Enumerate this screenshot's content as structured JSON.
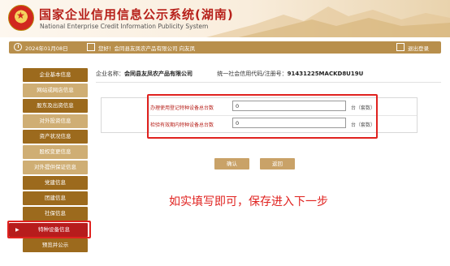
{
  "header": {
    "title": "国家企业信用信息公示系统",
    "province": "(湖南)",
    "subtitle": "National Enterprise Credit Information Publicity System"
  },
  "toolbar": {
    "date": "2024年01月08日",
    "welcome": "您好！会同县友凤农产品有限公司  向友凤",
    "logout_label": "退出登录"
  },
  "sidebar": {
    "items": [
      {
        "label": "企业基本信息",
        "style": "dark"
      },
      {
        "label": "网站或网店信息",
        "style": "light"
      },
      {
        "label": "股东及出资信息",
        "style": "dark"
      },
      {
        "label": "对外投资信息",
        "style": "light"
      },
      {
        "label": "资产状况信息",
        "style": "dark"
      },
      {
        "label": "股权变更信息",
        "style": "light"
      },
      {
        "label": "对外提供保证信息",
        "style": "light"
      },
      {
        "label": "党建信息",
        "style": "dark"
      },
      {
        "label": "团建信息",
        "style": "dark"
      },
      {
        "label": "社保信息",
        "style": "dark"
      },
      {
        "label": "特种设备信息",
        "style": "active"
      },
      {
        "label": "预览并公示",
        "style": "dark"
      }
    ]
  },
  "company": {
    "name_label": "企业名称：",
    "name": "会同县友凤农产品有限公司",
    "code_label": "统一社会信用代码/注册号：",
    "code": "91431225MACKD8U19U"
  },
  "form": {
    "fields": [
      {
        "label": "办理使用登记特种设备总台数",
        "value": "0",
        "unit": "台（套数）"
      },
      {
        "label": "检验有效期内特种设备总台数",
        "value": "0",
        "unit": "台（套数）"
      }
    ]
  },
  "buttons": {
    "confirm": "确认",
    "back": "返回"
  },
  "caption": "如实填写即可，保存进入下一步",
  "colors": {
    "header_title": "#b7211b",
    "toolbar": "#b88f4c",
    "sidebar_dark": "#9c6a1d",
    "sidebar_light": "#cfae74",
    "sidebar_active": "#b71c1c",
    "highlight": "#e0221f",
    "button": "#c9a268"
  }
}
